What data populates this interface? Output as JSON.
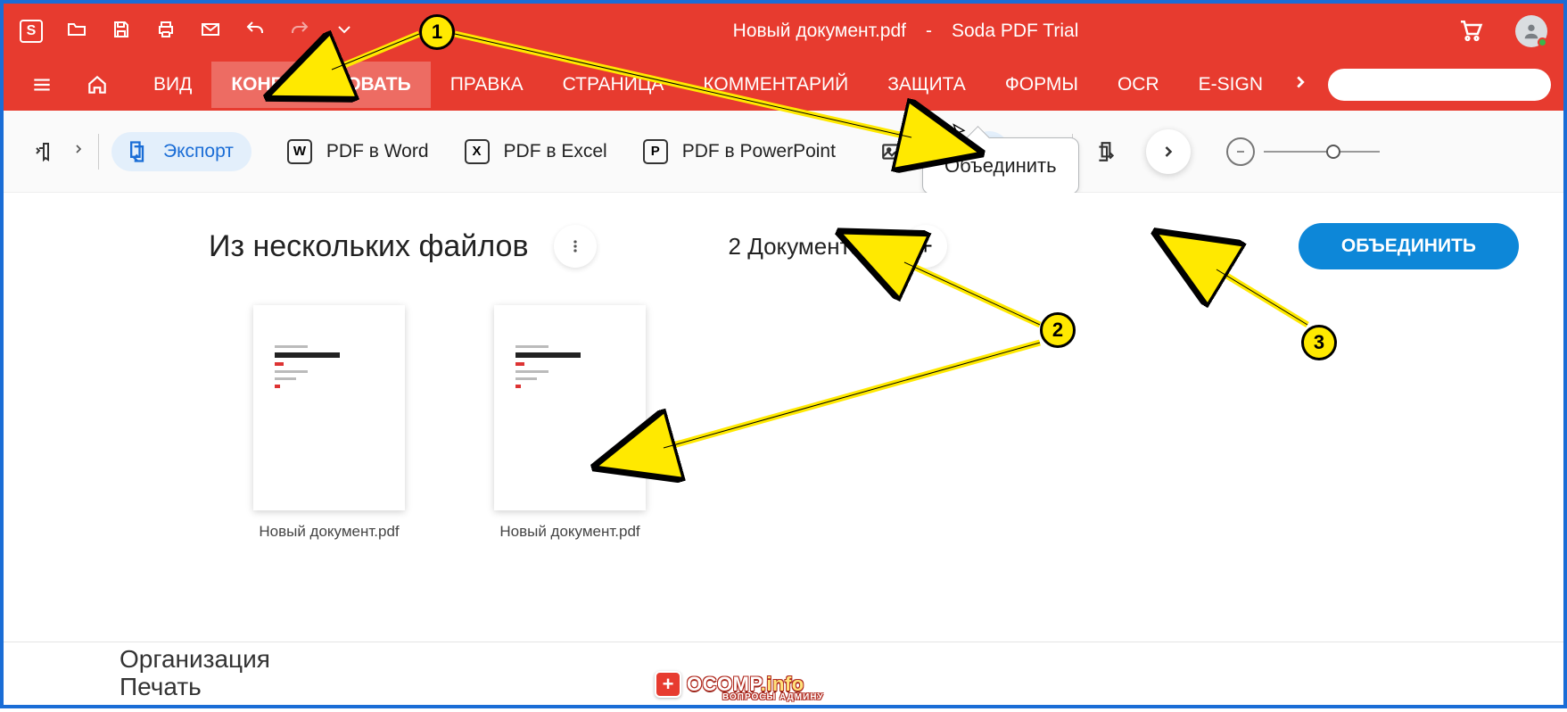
{
  "titlebar": {
    "logo_letter": "S",
    "doc_title": "Новый документ.pdf",
    "separator": "-",
    "app_name": "Soda PDF Trial"
  },
  "menu": {
    "items": [
      "ВИД",
      "КОНВЕРТИРОВАТЬ",
      "ПРАВКА",
      "СТРАНИЦА",
      "КОММЕНТАРИЙ",
      "ЗАЩИТА",
      "ФОРМЫ",
      "OCR",
      "E-SIGN"
    ],
    "active_index": 1
  },
  "toolbar": {
    "export_label": "Экспорт",
    "pdf_word": {
      "icon": "W",
      "label": "PDF в Word"
    },
    "pdf_excel": {
      "icon": "X",
      "label": "PDF в Excel"
    },
    "pdf_ppt": {
      "icon": "P",
      "label": "PDF в PowerPoint"
    }
  },
  "tooltip": {
    "merge": "Объединить"
  },
  "content": {
    "title": "Из нескольких файлов",
    "doc_count_label": "2 Документа",
    "merge_button": "ОБЪЕДИНИТЬ",
    "docs": [
      {
        "name": "Новый документ.pdf"
      },
      {
        "name": "Новый документ.pdf"
      }
    ]
  },
  "bottom": {
    "line1": "Организация",
    "line2": "Печать"
  },
  "watermark": {
    "main": "OCOMP",
    "suffix": ".info",
    "sub": "ВОПРОСЫ АДМИНУ"
  },
  "annotations": {
    "n1": "1",
    "n2": "2",
    "n3": "3"
  }
}
